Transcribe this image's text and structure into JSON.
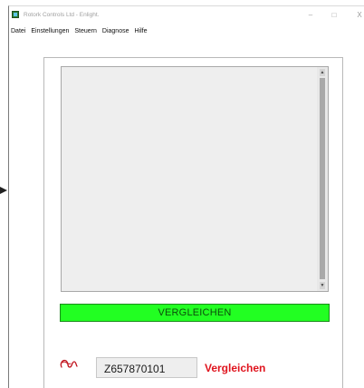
{
  "window": {
    "title": "Rotork Controls Ltd - Enlight.",
    "minimize": "–",
    "maximize": "□",
    "close": "X"
  },
  "menu": {
    "items": [
      {
        "label": "Datei"
      },
      {
        "label": "Einstellungen"
      },
      {
        "label": "Steuern"
      },
      {
        "label": "Diagnose"
      },
      {
        "label": "Hilfe"
      }
    ]
  },
  "panel": {
    "log_text": "",
    "scroll_up": "▲",
    "scroll_down": "▼",
    "compare_bar_label": "VERGLEICHEN",
    "compare_bar_color": "#22ff22",
    "logo_icon": "rotork-logo-icon",
    "serial_value": "Z657870101",
    "status_label": "Vergleichen",
    "status_color": "#e0141e"
  }
}
